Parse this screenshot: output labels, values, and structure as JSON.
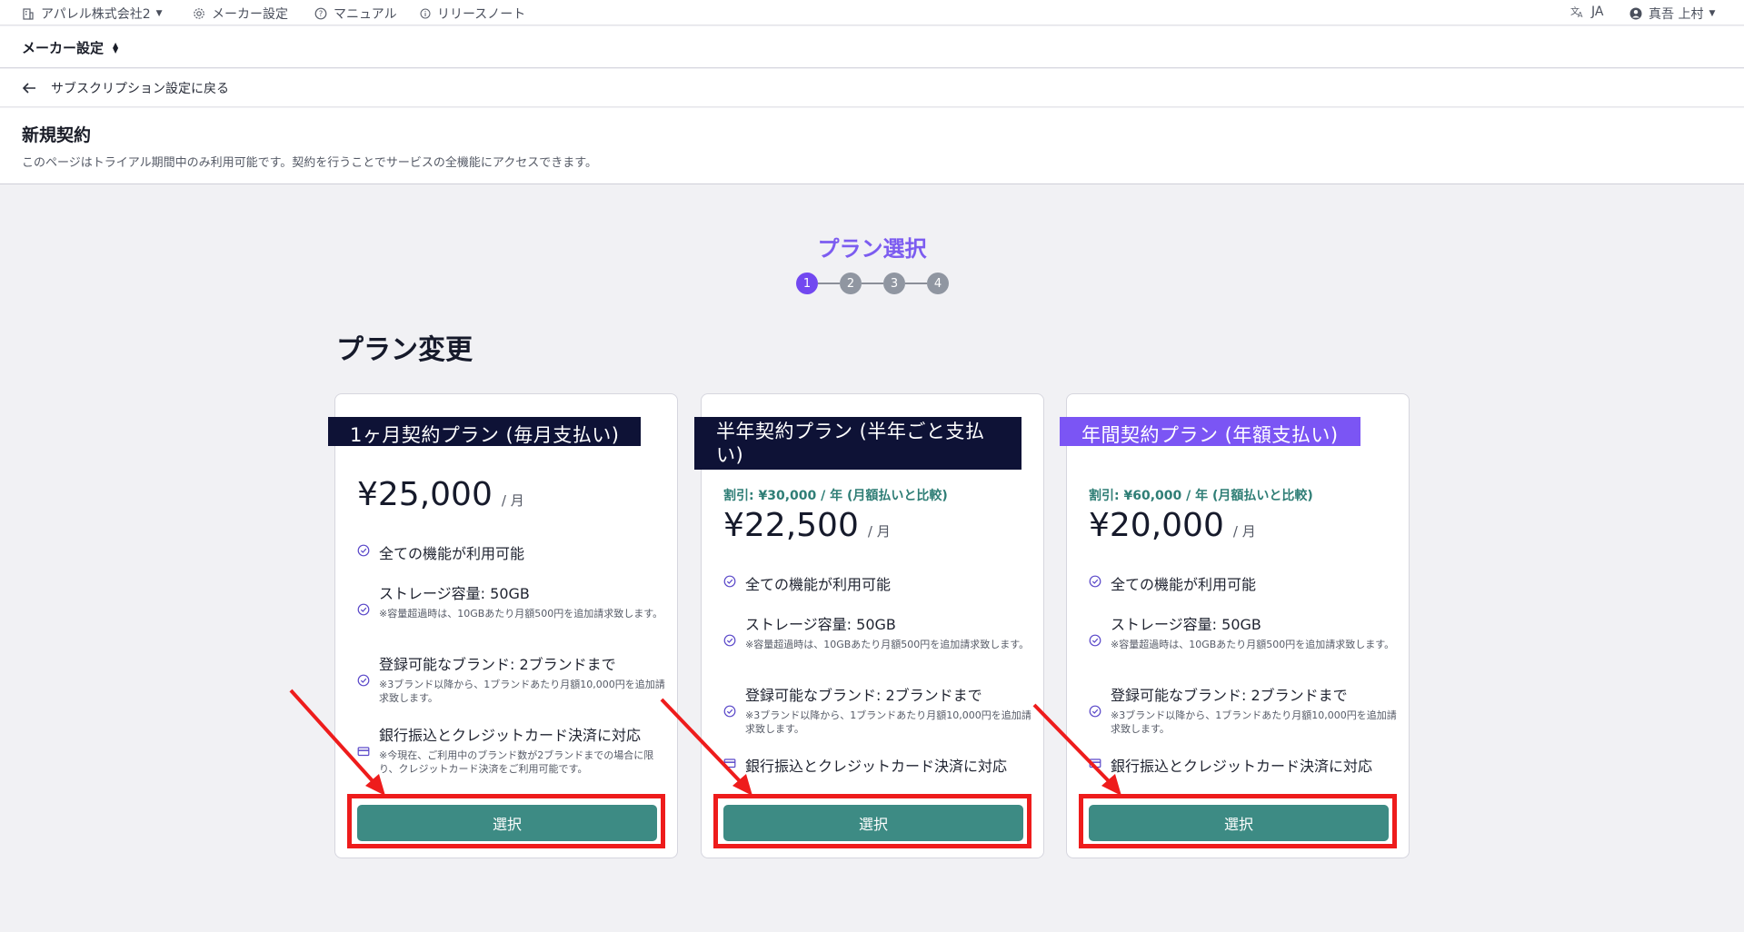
{
  "topbar": {
    "company": "アパレル株式会社2",
    "maker_settings": "メーカー設定",
    "manual": "マニュアル",
    "release_notes": "リリースノート",
    "language": "JA",
    "user": "真吾 上村"
  },
  "maker_bar": {
    "title": "メーカー設定"
  },
  "back_link": {
    "label": "サブスクリプション設定に戻る"
  },
  "page_header": {
    "title": "新規契約",
    "description": "このページはトライアル期間中のみ利用可能です。契約を行うことでサービスの全機能にアクセスできます。"
  },
  "stepper": {
    "title": "プラン選択",
    "steps": [
      "1",
      "2",
      "3",
      "4"
    ],
    "active_step": 1
  },
  "section_title": "プラン変更",
  "plans": [
    {
      "name": "1ヶ月契約プラン (毎月支払い)",
      "discount": "",
      "price": "¥25,000",
      "per": "/ 月",
      "features": [
        {
          "text": "全ての機能が利用可能",
          "note": ""
        },
        {
          "text": "ストレージ容量: 50GB",
          "note": "※容量超過時は、10GBあたり月額500円を追加請求致します。"
        },
        {
          "text": "登録可能なブランド: 2ブランドまで",
          "note": "※3ブランド以降から、1ブランドあたり月額10,000円を追加請求致します。"
        },
        {
          "text": "銀行振込とクレジットカード決済に対応",
          "note": "※今現在、ご利用中のブランド数が2ブランドまでの場合に限り、クレジットカード決済をご利用可能です。"
        }
      ],
      "button": "選択"
    },
    {
      "name": "半年契約プラン (半年ごと支払い)",
      "discount": "割引: ¥30,000 / 年 (月額払いと比較)",
      "price": "¥22,500",
      "per": "/ 月",
      "features": [
        {
          "text": "全ての機能が利用可能",
          "note": ""
        },
        {
          "text": "ストレージ容量: 50GB",
          "note": "※容量超過時は、10GBあたり月額500円を追加請求致します。"
        },
        {
          "text": "登録可能なブランド: 2ブランドまで",
          "note": "※3ブランド以降から、1ブランドあたり月額10,000円を追加請求致します。"
        },
        {
          "text": "銀行振込とクレジットカード決済に対応",
          "note": ""
        }
      ],
      "button": "選択"
    },
    {
      "name": "年間契約プラン (年額支払い)",
      "discount": "割引: ¥60,000 / 年 (月額払いと比較)",
      "price": "¥20,000",
      "per": "/ 月",
      "features": [
        {
          "text": "全ての機能が利用可能",
          "note": ""
        },
        {
          "text": "ストレージ容量: 50GB",
          "note": "※容量超過時は、10GBあたり月額500円を追加請求致します。"
        },
        {
          "text": "登録可能なブランド: 2ブランドまで",
          "note": "※3ブランド以降から、1ブランドあたり月額10,000円を追加請求致します。"
        },
        {
          "text": "銀行振込とクレジットカード決済に対応",
          "note": ""
        }
      ],
      "button": "選択"
    }
  ],
  "colors": {
    "accent": "#7248f0",
    "button": "#3d8b84",
    "ribbon_dark": "#0e1236",
    "ribbon_purple": "#7b55f4",
    "discount": "#2f7e76",
    "annotation": "#ee1c1c"
  },
  "icons": {
    "building": "building-icon",
    "gear": "gear-icon",
    "help": "help-circle-icon",
    "info": "info-icon",
    "translate": "translate-icon",
    "user": "user-circle-icon",
    "back": "arrow-left-icon",
    "check": "check-circle-icon",
    "card": "credit-card-icon"
  }
}
